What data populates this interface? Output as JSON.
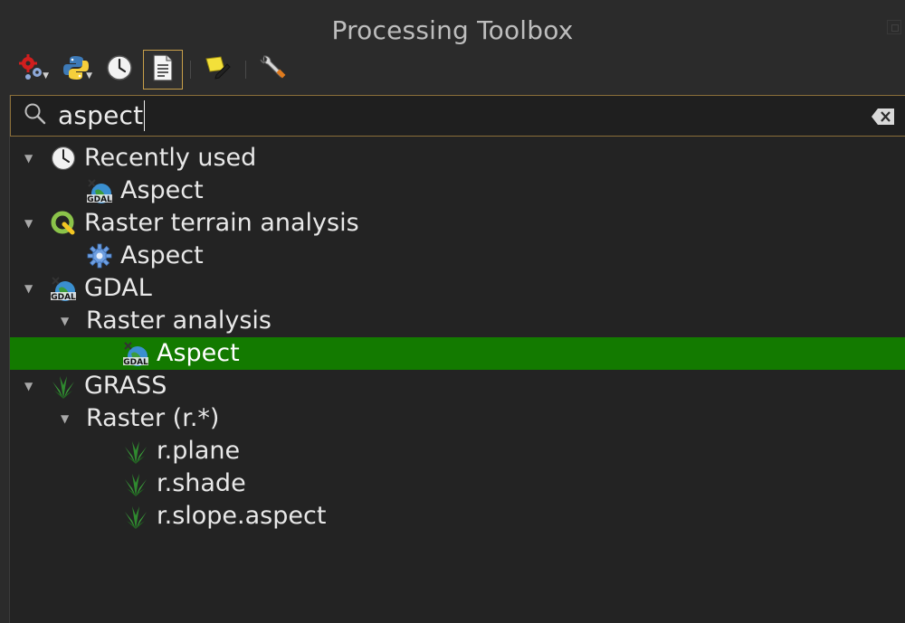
{
  "window": {
    "title": "Processing Toolbox"
  },
  "toolbar": {
    "buttons": [
      {
        "icon": "models-gear-icon"
      },
      {
        "icon": "python-icon"
      },
      {
        "icon": "history-clock-icon"
      },
      {
        "icon": "results-document-icon",
        "active": true
      },
      {
        "icon": "edit-features-pencil-icon"
      },
      {
        "icon": "options-wrench-icon"
      }
    ]
  },
  "search": {
    "value": "aspect"
  },
  "tree": {
    "recently_used": {
      "label": "Recently used",
      "icon": "clock-icon",
      "children": [
        {
          "label": "Aspect",
          "icon": "gdal-icon"
        }
      ]
    },
    "raster_terrain": {
      "label": "Raster terrain analysis",
      "icon": "qgis-icon",
      "children": [
        {
          "label": "Aspect",
          "icon": "gear-icon"
        }
      ]
    },
    "gdal": {
      "label": "GDAL",
      "icon": "gdal-icon",
      "group": {
        "label": "Raster analysis",
        "children": [
          {
            "label": "Aspect",
            "icon": "gdal-icon",
            "selected": true
          }
        ]
      }
    },
    "grass": {
      "label": "GRASS",
      "icon": "grass-icon",
      "group": {
        "label": "Raster (r.*)",
        "children": [
          {
            "label": "r.plane",
            "icon": "grass-icon"
          },
          {
            "label": "r.shade",
            "icon": "grass-icon"
          },
          {
            "label": "r.slope.aspect",
            "icon": "grass-icon"
          }
        ]
      }
    }
  },
  "colors": {
    "selection": "#137a00",
    "background": "#232323",
    "search_border": "#8a6f3a"
  }
}
